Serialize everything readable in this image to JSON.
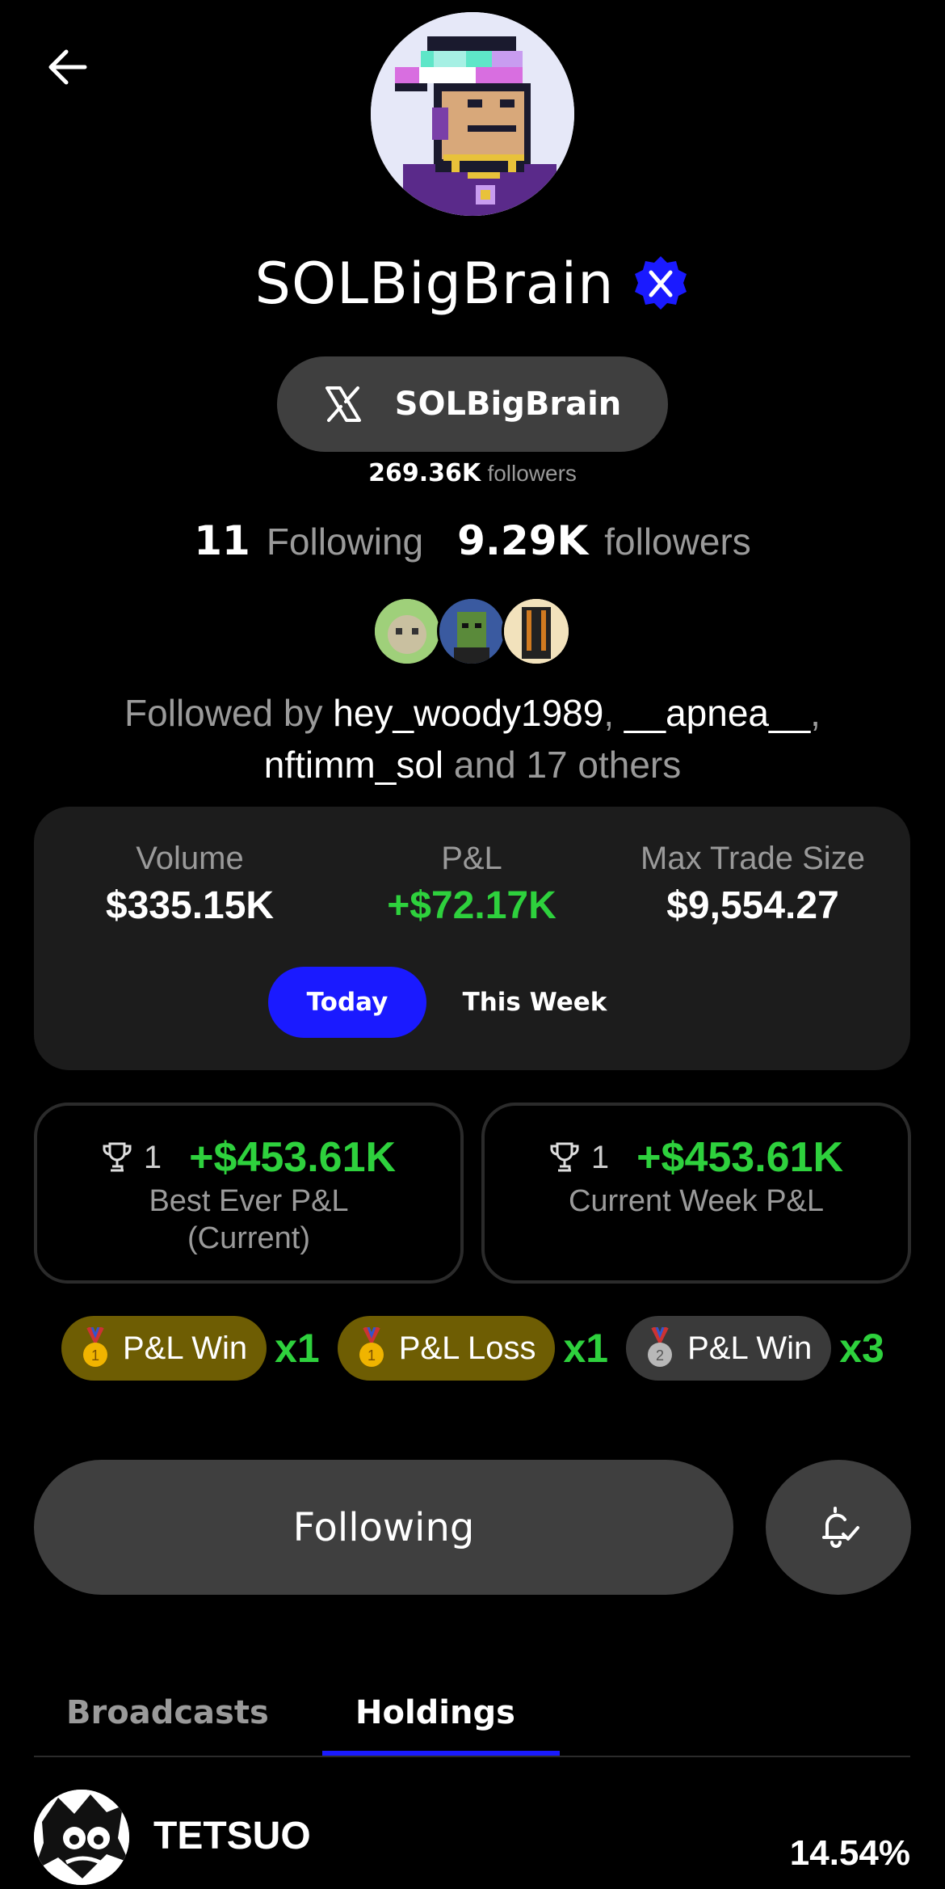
{
  "profile": {
    "name": "SOLBigBrain",
    "x_handle": "SOLBigBrain",
    "x_followers_value": "269.36K",
    "x_followers_label": "followers",
    "following_count": "11",
    "following_label": "Following",
    "followers_count": "9.29K",
    "followers_label": "followers"
  },
  "followed_by": {
    "prefix": "Followed by",
    "user1": "hey_woody1989",
    "sep1": ",",
    "user2": "__apnea__",
    "sep2": ",",
    "user3": "nftimm_sol",
    "suffix": "and 17 others"
  },
  "metrics": {
    "volume_label": "Volume",
    "volume_value": "$335.15K",
    "pl_label": "P&L",
    "pl_value": "+$72.17K",
    "max_label": "Max Trade Size",
    "max_value": "$9,554.27",
    "period_today": "Today",
    "period_week": "This Week",
    "selected_period": "Today"
  },
  "pl_cards": [
    {
      "rank": "1",
      "amount": "+$453.61K",
      "line1": "Best Ever P&L",
      "line2": "(Current)"
    },
    {
      "rank": "1",
      "amount": "+$453.61K",
      "line1": "Current Week P&L",
      "line2": ""
    }
  ],
  "badges": [
    {
      "medal": "1",
      "label": "P&L Win",
      "mult": "x1",
      "tier": "gold"
    },
    {
      "medal": "1",
      "label": "P&L Loss",
      "mult": "x1",
      "tier": "gold"
    },
    {
      "medal": "2",
      "label": "P&L Win",
      "mult": "x3",
      "tier": "silver"
    }
  ],
  "actions": {
    "following_label": "Following"
  },
  "tabs": {
    "broadcasts": "Broadcasts",
    "holdings": "Holdings",
    "active": "Holdings"
  },
  "holdings": [
    {
      "name": "TETSUO",
      "percent": "14.54%"
    }
  ],
  "colors": {
    "accent_blue": "#1a1aff",
    "gain_green": "#2ed13d",
    "gold_badge": "#6e5d03"
  }
}
